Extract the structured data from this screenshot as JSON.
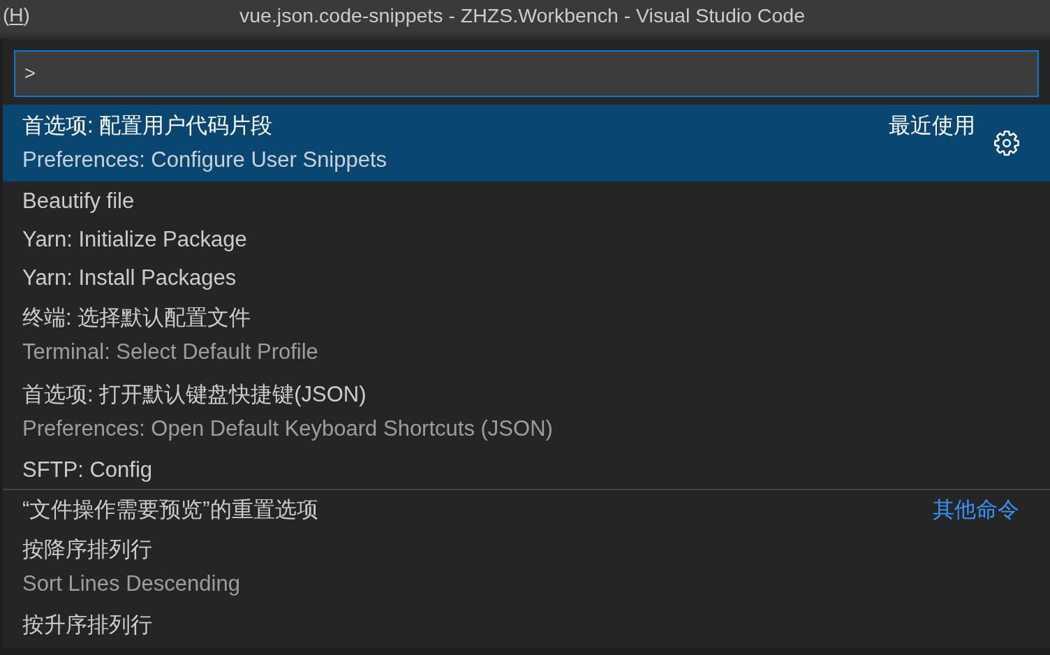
{
  "title_bar": {
    "menu_item": {
      "before": "(",
      "mnemonic": "H",
      "after": ")"
    },
    "title": "vue.json.code-snippets - ZHZS.Workbench - Visual Studio Code"
  },
  "quick_pick": {
    "input": {
      "value": ">"
    },
    "groups": [
      {
        "label": "最近使用",
        "items": [
          {
            "label": "首选项: 配置用户代码片段",
            "detail": "Preferences: Configure User Snippets",
            "selected": true,
            "settings_button": true
          },
          {
            "label": "Beautify file",
            "selected": false
          },
          {
            "label": "Yarn: Initialize Package",
            "selected": false
          },
          {
            "label": "Yarn: Install Packages",
            "selected": false
          },
          {
            "label": "终端: 选择默认配置文件",
            "detail": "Terminal: Select Default Profile",
            "selected": false
          },
          {
            "label": "首选项: 打开默认键盘快捷键(JSON)",
            "detail": "Preferences: Open Default Keyboard Shortcuts (JSON)",
            "selected": false
          },
          {
            "label": "SFTP: Config",
            "selected": false
          }
        ]
      },
      {
        "label": "其他命令",
        "items": [
          {
            "label": "“文件操作需要预览”的重置选项",
            "selected": false
          },
          {
            "label": "按降序排列行",
            "detail": "Sort Lines Descending",
            "selected": false
          },
          {
            "label": "按升序排列行",
            "selected": false
          }
        ]
      }
    ]
  }
}
